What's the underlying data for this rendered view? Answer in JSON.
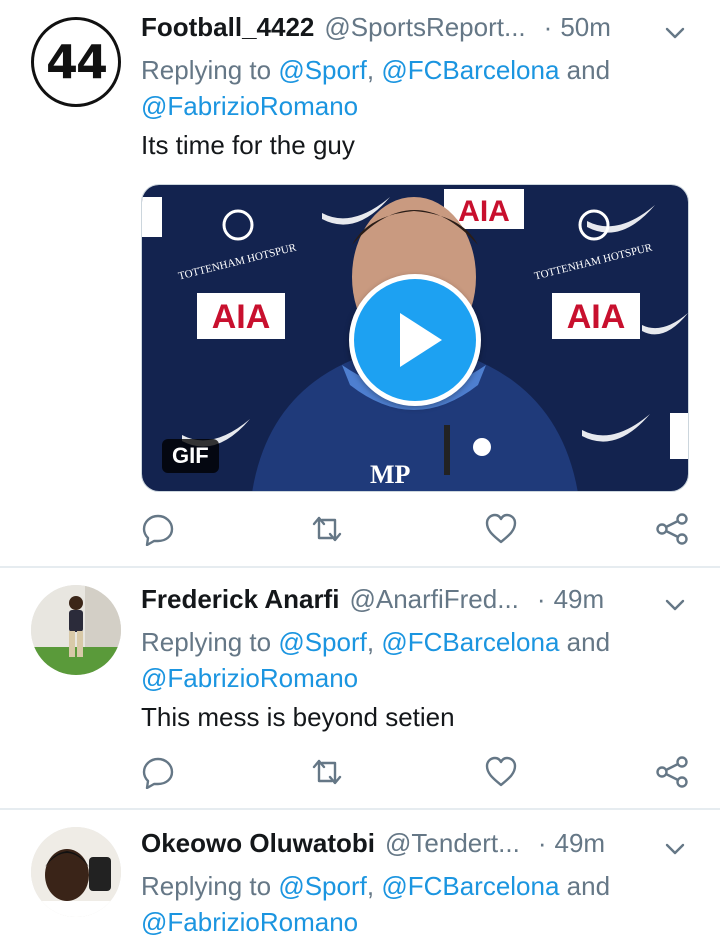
{
  "tweets": [
    {
      "avatar_text": "44",
      "name": "Football_4422",
      "handle": "@SportsReport...",
      "dot": "·",
      "time": "50m",
      "reply_prefix": "Replying to ",
      "mention1": "@Sporf",
      "sep": ", ",
      "mention2": "@FCBarcelona",
      "and": " and",
      "mention3": "@FabrizioRomano",
      "text": "Its time for the guy",
      "media": {
        "badge": "GIF",
        "sponsor": "AIA",
        "club": "TOTTENHAM HOTSPUR",
        "initials": "MP"
      }
    },
    {
      "name": "Frederick Anarfi",
      "handle": "@AnarfiFred...",
      "dot": "·",
      "time": "49m",
      "reply_prefix": "Replying to ",
      "mention1": "@Sporf",
      "sep": ", ",
      "mention2": "@FCBarcelona",
      "and": " and",
      "mention3": "@FabrizioRomano",
      "text": "This mess is beyond setien"
    },
    {
      "name": "Okeowo Oluwatobi",
      "handle": "@Tendert...",
      "dot": "·",
      "time": "49m",
      "reply_prefix": "Replying to ",
      "mention1": "@Sporf",
      "sep": ", ",
      "mention2": "@FCBarcelona",
      "and": " and",
      "mention3": "@FabrizioRomano"
    }
  ],
  "icons": {
    "reply": "reply-icon",
    "retweet": "retweet-icon",
    "like": "like-icon",
    "share": "share-icon",
    "more": "chevron-down-icon"
  },
  "colors": {
    "link": "#1b95e0",
    "muted": "#657786",
    "play": "#1da1f2",
    "divider": "#e6ecf0"
  }
}
